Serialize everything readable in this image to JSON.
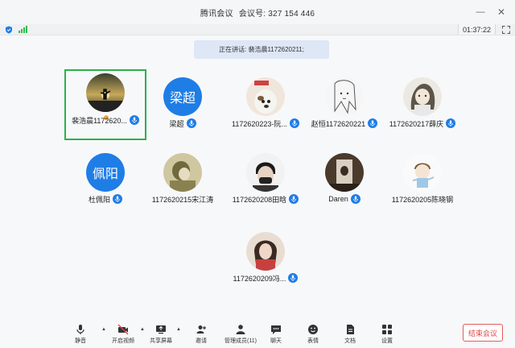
{
  "window": {
    "app_name": "腾讯会议",
    "meeting_label": "会议号:",
    "meeting_id": "327 154 446"
  },
  "status": {
    "timer": "01:37:22"
  },
  "speaking": {
    "text": "正在讲话: 裴浩晨1172620211;"
  },
  "participants": [
    {
      "name": "裴浩晨1172620...",
      "avatar_type": "photo",
      "avatar_desc": "sunset-silhouette",
      "active": true,
      "host": true
    },
    {
      "name": "梁超",
      "avatar_type": "text",
      "avatar_text": "梁超",
      "active": false
    },
    {
      "name": "1172620223-阮...",
      "avatar_type": "photo",
      "avatar_desc": "cartoon-dog"
    },
    {
      "name": "赵恒1172620221",
      "avatar_type": "photo",
      "avatar_desc": "anime-sketch"
    },
    {
      "name": "1172620217薛庆",
      "avatar_type": "photo",
      "avatar_desc": "cartoon-girl"
    },
    {
      "name": "杜佩阳",
      "avatar_type": "text",
      "avatar_text": "佩阳"
    },
    {
      "name": "1172620215宋江涛",
      "avatar_type": "photo",
      "avatar_desc": "olive-figure"
    },
    {
      "name": "1172620208田晗",
      "avatar_type": "photo",
      "avatar_desc": "masked-person"
    },
    {
      "name": "Daren",
      "avatar_type": "photo",
      "avatar_desc": "room-photo"
    },
    {
      "name": "1172620205陈晓钢",
      "avatar_type": "photo",
      "avatar_desc": "cartoon-boy"
    },
    {
      "name": "1172620209冯...",
      "avatar_type": "photo",
      "avatar_desc": "red-portrait"
    }
  ],
  "toolbar": {
    "mute": "静音",
    "video": "开启视频",
    "share": "共享屏幕",
    "invite": "邀请",
    "members": "管理成员(11)",
    "chat": "聊天",
    "reaction": "表情",
    "docs": "文档",
    "settings": "设置",
    "end": "结束会议"
  },
  "icons": [
    "shield-icon",
    "signal-icon",
    "fullscreen-icon",
    "minimize-icon",
    "close-icon",
    "mic-icon",
    "video-off-icon",
    "share-screen-icon",
    "invite-icon",
    "members-icon",
    "chat-icon",
    "emoji-icon",
    "document-icon",
    "settings-icon"
  ],
  "colors": {
    "accent": "#1f7de6",
    "active_border": "#2bb14a",
    "end": "#e04848"
  }
}
